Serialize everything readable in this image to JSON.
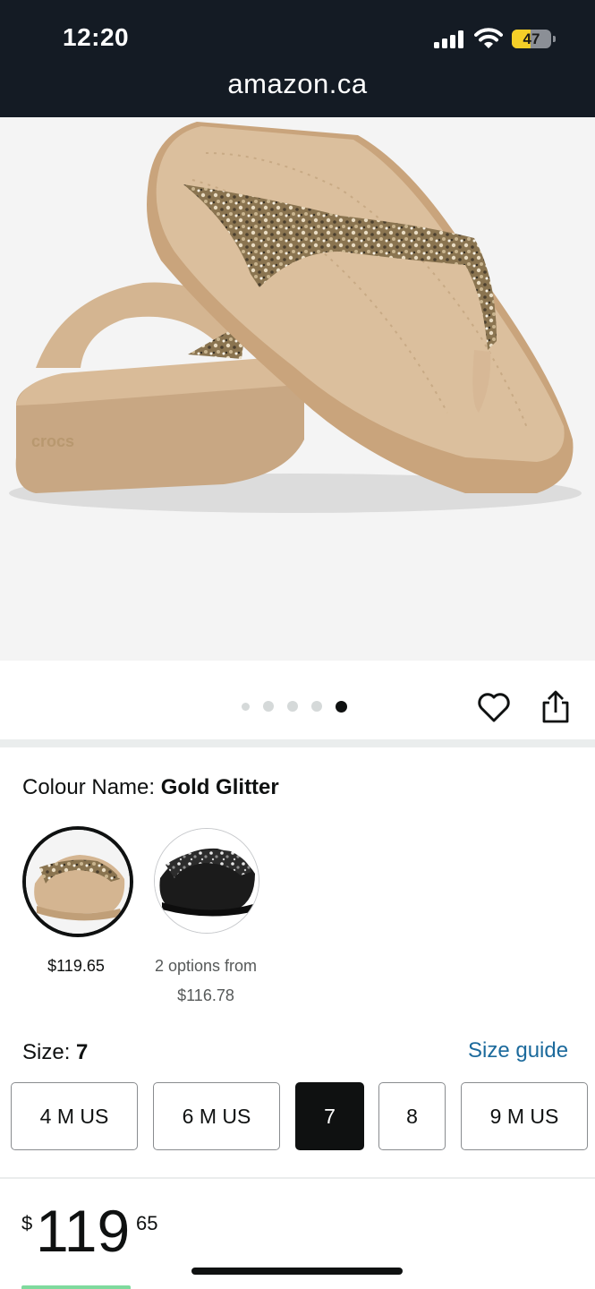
{
  "status_bar": {
    "time": "12:20",
    "battery_level": "47",
    "battery_fraction": 0.47
  },
  "browser": {
    "url": "amazon.ca"
  },
  "gallery": {
    "dot_count": 5,
    "active_index": 4
  },
  "colour": {
    "label": "Colour Name:",
    "value": "Gold Glitter"
  },
  "swatches": [
    {
      "name": "Gold Glitter",
      "price": "$119.65",
      "selected": true
    },
    {
      "name": "Black",
      "price_line1": "2 options from",
      "price_line2": "$116.78",
      "selected": false
    }
  ],
  "size": {
    "label": "Size:",
    "value": "7",
    "guide_link": "Size guide",
    "options": [
      "4 M US",
      "6 M US",
      "7",
      "8",
      "9 M US"
    ],
    "selected": "7"
  },
  "price": {
    "symbol": "$",
    "whole": "119",
    "fraction": "65"
  },
  "colors": {
    "header_bg": "#141b24",
    "link": "#1c6a9c",
    "sandal": "#d7b896",
    "glitter": "#a08a66",
    "selected_size_bg": "#0f1111"
  }
}
